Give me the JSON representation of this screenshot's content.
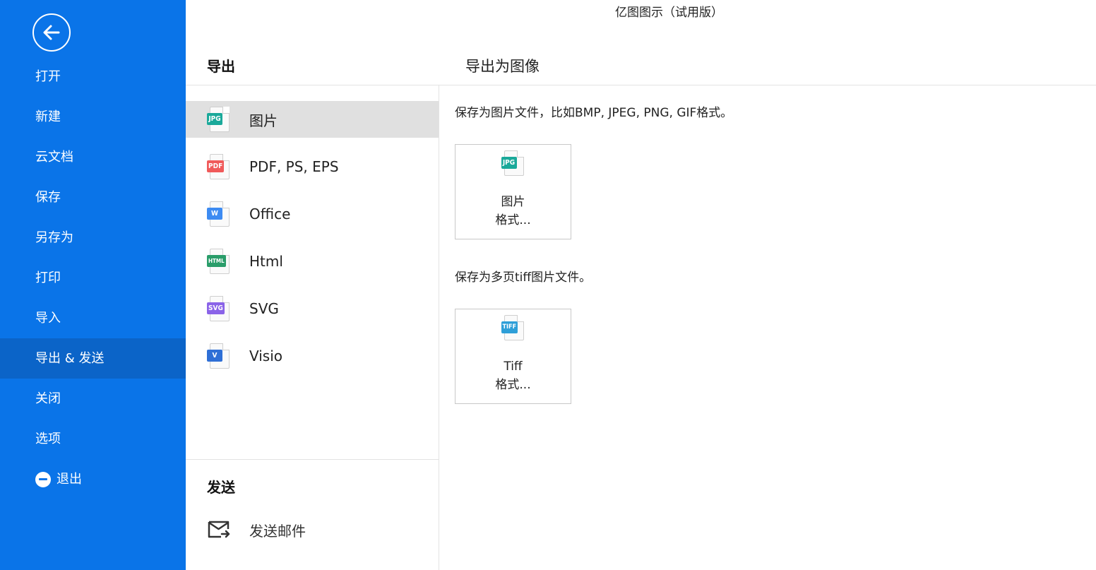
{
  "window_title": "亿图图示（试用版）",
  "sidebar": {
    "items": [
      {
        "label": "打开"
      },
      {
        "label": "新建"
      },
      {
        "label": "云文档"
      },
      {
        "label": "保存"
      },
      {
        "label": "另存为"
      },
      {
        "label": "打印"
      },
      {
        "label": "导入"
      },
      {
        "label": "导出 & 发送"
      },
      {
        "label": "关闭"
      },
      {
        "label": "选项"
      },
      {
        "label": "退出"
      }
    ],
    "active": "导出 & 发送",
    "bg_color": "#0a74e8",
    "active_color": "#0b64c8"
  },
  "export": {
    "header": "导出",
    "formats": [
      {
        "label": "图片",
        "tag": "JPG",
        "tag_color": "#1aa99a",
        "icon": "jpg-file-icon"
      },
      {
        "label": "PDF, PS, EPS",
        "tag": "PDF",
        "tag_color": "#f05a5a",
        "icon": "pdf-file-icon"
      },
      {
        "label": "Office",
        "tag": "W",
        "tag_color": "#3d8bf2",
        "icon": "word-file-icon"
      },
      {
        "label": "Html",
        "tag": "HTML",
        "tag_color": "#2a9d6a",
        "icon": "html-file-icon"
      },
      {
        "label": "SVG",
        "tag": "SVG",
        "tag_color": "#8a63e8",
        "icon": "svg-file-icon"
      },
      {
        "label": "Visio",
        "tag": "V",
        "tag_color": "#2f6fd6",
        "icon": "visio-file-icon"
      }
    ],
    "selected": "图片"
  },
  "send": {
    "header": "发送",
    "items": [
      {
        "label": "发送邮件",
        "icon": "mail-send-icon"
      }
    ]
  },
  "main": {
    "header": "导出为图像",
    "sections": [
      {
        "description": "保存为图片文件，比如BMP, JPEG, PNG, GIF格式。",
        "card": {
          "tag": "JPG",
          "tag_color": "#1aa99a",
          "line1": "图片",
          "line2": "格式..."
        }
      },
      {
        "description": "保存为多页tiff图片文件。",
        "card": {
          "tag": "TIFF",
          "tag_color": "#2e9fd8",
          "line1": "Tiff",
          "line2": "格式..."
        }
      }
    ]
  }
}
